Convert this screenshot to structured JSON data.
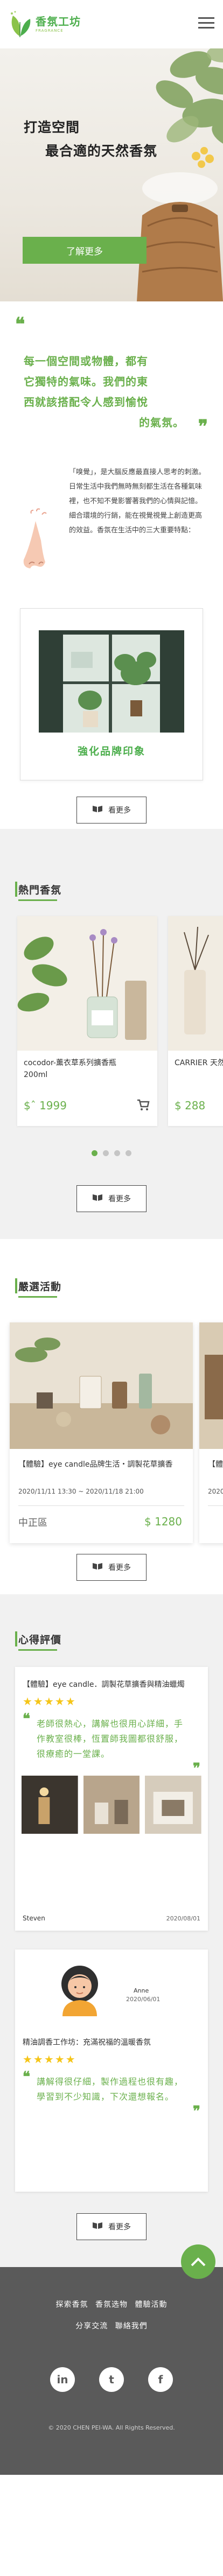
{
  "brand": {
    "name_cn": "香氛工坊",
    "name_en": "FRAGRANCE"
  },
  "hero": {
    "title_line1": "打造空間",
    "title_line2": "最合適的天然香氛",
    "cta_label": "了解更多"
  },
  "intro": {
    "quote_lines": [
      "每一個空間或物體，都有",
      "它獨特的氣味。我們的東",
      "西就該搭配令人感到愉悅",
      "的氣氛。"
    ],
    "body": "「嗅覺」，是大腦反應最直接人思考的刺激。日常生活中我們無時無刻都生活在各種氣味裡，也不知不覺影響著我們的心情與記憶。細合環境的行銷，能在視覺視覺上創造更高的效益。香氛在生活中的三大重要特點：",
    "brand_caption": "強化品牌印象",
    "more_label": "看更多"
  },
  "products": {
    "heading": "熱門香氛",
    "items": [
      {
        "name": "cocodor-薰衣草系列擴香瓶200ml",
        "price": "$ˆ 1999"
      },
      {
        "name": "CARRIER 天然擴香",
        "price": "$ 288"
      }
    ],
    "more_label": "看更多"
  },
  "events": {
    "heading": "嚴選活動",
    "items": [
      {
        "title": "【體驗】eye candle品牌生活・調製花草擴香",
        "date": "2020/11/11 13:30 ~ 2020/11/18 21:00",
        "location": "中正區",
        "price": "$ 1280"
      },
      {
        "title": "【體驗】",
        "date": "2020/1",
        "location": "",
        "price": ""
      }
    ],
    "more_label": "看更多"
  },
  "reviews": {
    "heading": "心得評價",
    "items": [
      {
        "title": "【體驗】eye candle．調製花草擴香與精油蠟燭",
        "stars": "★★★★★",
        "quote": "老師很熱心，講解也很用心詳細，手作教室很棒，恆置師我圖都很舒服，很療癒的一堂課。",
        "user": "Steven",
        "date": "2020/08/01"
      },
      {
        "title": "精油調香工作坊：充滿祝福的溫暖香氛",
        "stars": "★★★★★",
        "quote": "講解得很仔細，製作過程也很有趣，學習到不少知識，下次還想報名。",
        "user": "Anne",
        "date": "2020/06/01"
      }
    ],
    "more_label": "看更多"
  },
  "footer": {
    "links_row1": [
      "探索香氛",
      "香氛选物",
      "體驗活動"
    ],
    "links_row2": [
      "分享交流",
      "聯絡我們"
    ],
    "socials": [
      "in",
      "t",
      "f"
    ],
    "copyright": "© 2020 CHEN PEI-WA. All Rights Reserved."
  },
  "colors": {
    "accent": "#6ab04c",
    "footer_bg": "#5a5a5a",
    "section_bg": "#f1f1f1",
    "star": "#f5c518"
  }
}
